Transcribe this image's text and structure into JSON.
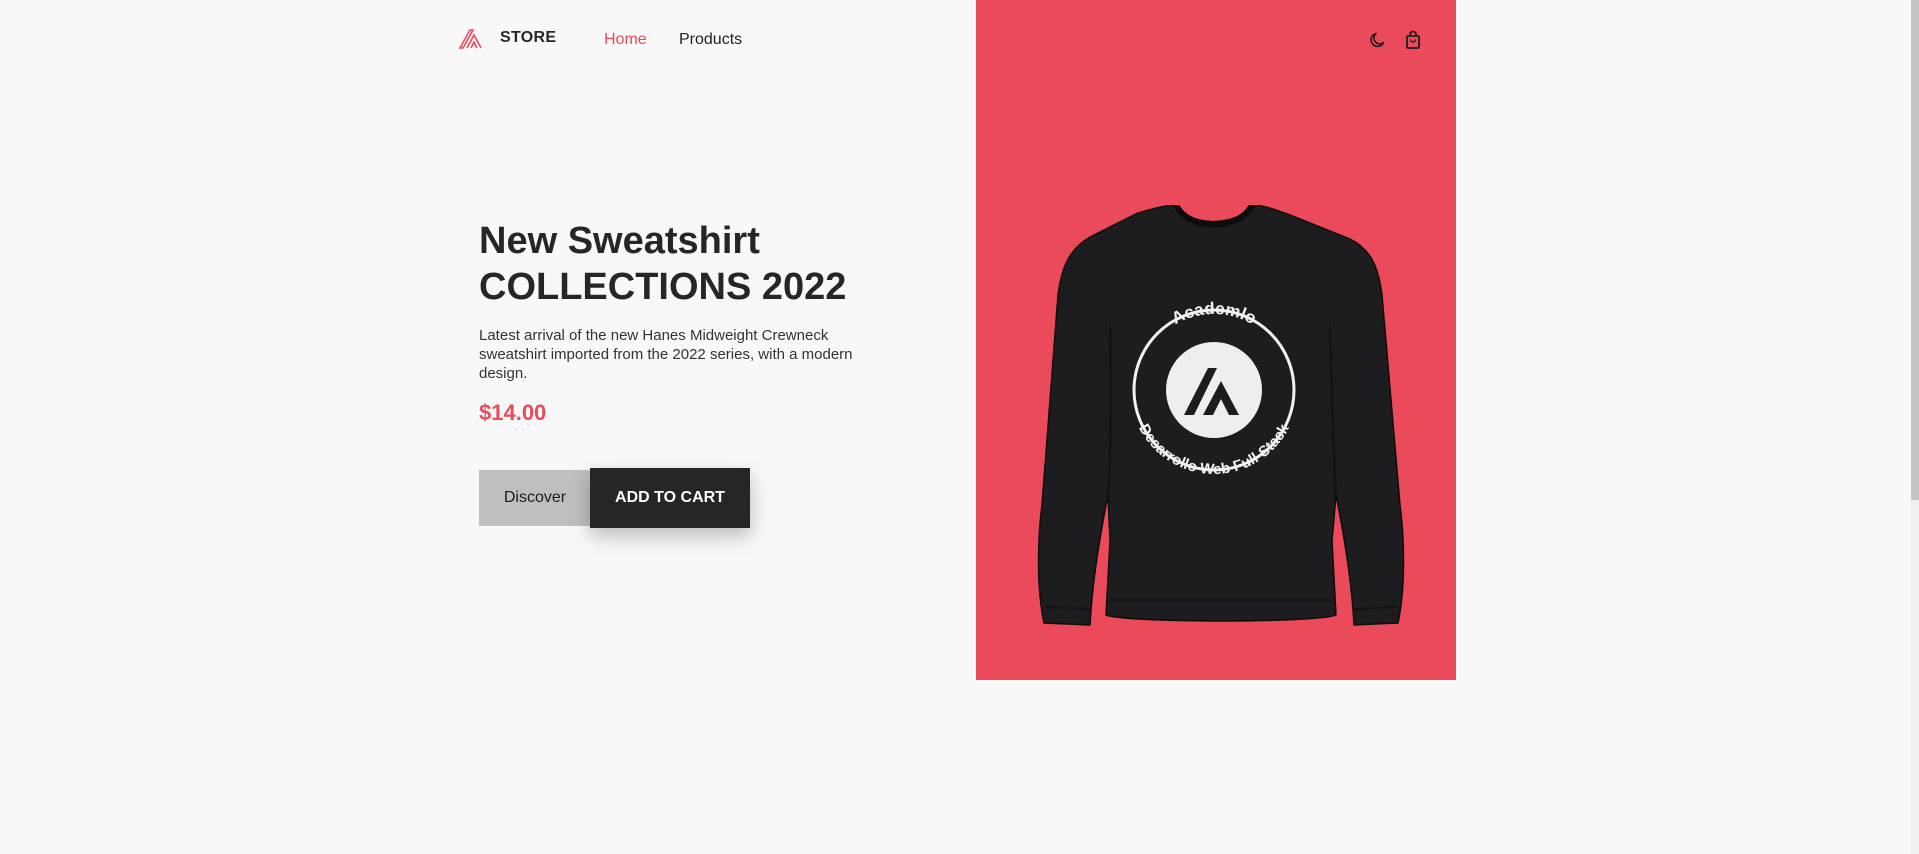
{
  "header": {
    "logo_text": "STORE",
    "nav": [
      {
        "label": "Home",
        "active": true
      },
      {
        "label": "Products",
        "active": false
      }
    ],
    "icons": [
      "moon-icon",
      "shopping-bag-icon"
    ]
  },
  "hero": {
    "title_line1": "New Sweatshirt",
    "title_line2": "COLLECTIONS 2022",
    "description": "Latest arrival of the new Hanes Midweight Crewneck sweatshirt imported from the 2022 series, with a modern design.",
    "price": "$14.00",
    "discover_label": "Discover",
    "add_to_cart_label": "ADD TO CART",
    "image": {
      "badge_top_text": "Academlo",
      "badge_bottom_text": "Desarrollo Web Full-Stack"
    }
  },
  "colors": {
    "accent": "#eb4a5a",
    "dark": "#262626",
    "background": "#f8f8f9",
    "discover_bg": "#bfbfbf"
  }
}
